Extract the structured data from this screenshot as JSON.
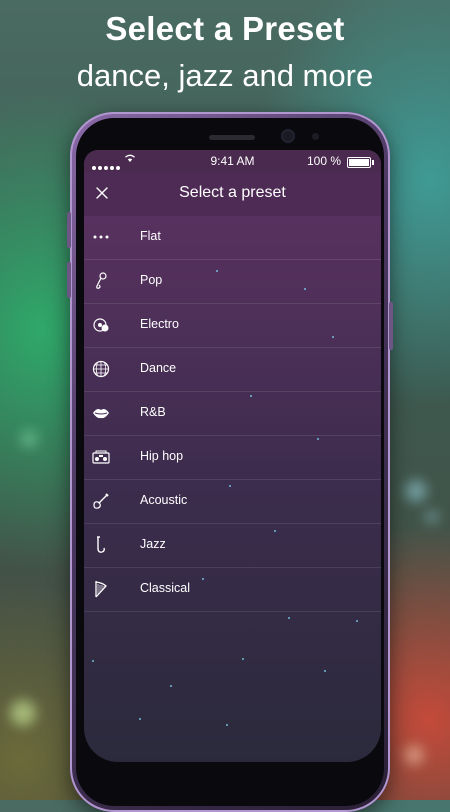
{
  "promo": {
    "title": "Select a Preset",
    "subtitle": "dance, jazz and more"
  },
  "status_bar": {
    "time": "9:41 AM",
    "battery": "100 %"
  },
  "header": {
    "title": "Select a preset",
    "close_icon": "close-icon"
  },
  "presets": [
    {
      "label": "Flat",
      "icon": "dots-icon"
    },
    {
      "label": "Pop",
      "icon": "microphone-icon"
    },
    {
      "label": "Electro",
      "icon": "record-icon"
    },
    {
      "label": "Dance",
      "icon": "disco-ball-icon"
    },
    {
      "label": "R&B",
      "icon": "lips-icon"
    },
    {
      "label": "Hip hop",
      "icon": "boombox-icon"
    },
    {
      "label": "Acoustic",
      "icon": "guitar-icon"
    },
    {
      "label": "Jazz",
      "icon": "saxophone-icon"
    },
    {
      "label": "Classical",
      "icon": "harp-icon"
    }
  ],
  "colors": {
    "header_bg": "#4e2b55",
    "list_top": "#5e3264",
    "list_bottom": "#2b2a3c",
    "accent": "#7fe0ff"
  }
}
